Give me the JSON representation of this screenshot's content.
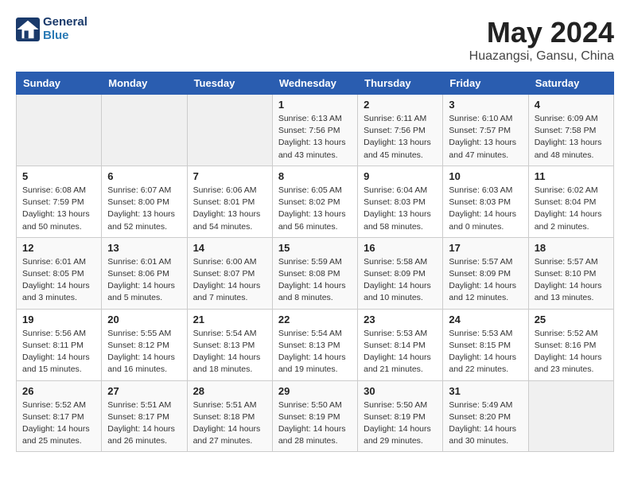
{
  "header": {
    "logo_text_general": "General",
    "logo_text_blue": "Blue",
    "month": "May 2024",
    "location": "Huazangsi, Gansu, China"
  },
  "days_of_week": [
    "Sunday",
    "Monday",
    "Tuesday",
    "Wednesday",
    "Thursday",
    "Friday",
    "Saturday"
  ],
  "weeks": [
    [
      {
        "day": "",
        "info": ""
      },
      {
        "day": "",
        "info": ""
      },
      {
        "day": "",
        "info": ""
      },
      {
        "day": "1",
        "info": "Sunrise: 6:13 AM\nSunset: 7:56 PM\nDaylight: 13 hours\nand 43 minutes."
      },
      {
        "day": "2",
        "info": "Sunrise: 6:11 AM\nSunset: 7:56 PM\nDaylight: 13 hours\nand 45 minutes."
      },
      {
        "day": "3",
        "info": "Sunrise: 6:10 AM\nSunset: 7:57 PM\nDaylight: 13 hours\nand 47 minutes."
      },
      {
        "day": "4",
        "info": "Sunrise: 6:09 AM\nSunset: 7:58 PM\nDaylight: 13 hours\nand 48 minutes."
      }
    ],
    [
      {
        "day": "5",
        "info": "Sunrise: 6:08 AM\nSunset: 7:59 PM\nDaylight: 13 hours\nand 50 minutes."
      },
      {
        "day": "6",
        "info": "Sunrise: 6:07 AM\nSunset: 8:00 PM\nDaylight: 13 hours\nand 52 minutes."
      },
      {
        "day": "7",
        "info": "Sunrise: 6:06 AM\nSunset: 8:01 PM\nDaylight: 13 hours\nand 54 minutes."
      },
      {
        "day": "8",
        "info": "Sunrise: 6:05 AM\nSunset: 8:02 PM\nDaylight: 13 hours\nand 56 minutes."
      },
      {
        "day": "9",
        "info": "Sunrise: 6:04 AM\nSunset: 8:03 PM\nDaylight: 13 hours\nand 58 minutes."
      },
      {
        "day": "10",
        "info": "Sunrise: 6:03 AM\nSunset: 8:03 PM\nDaylight: 14 hours\nand 0 minutes."
      },
      {
        "day": "11",
        "info": "Sunrise: 6:02 AM\nSunset: 8:04 PM\nDaylight: 14 hours\nand 2 minutes."
      }
    ],
    [
      {
        "day": "12",
        "info": "Sunrise: 6:01 AM\nSunset: 8:05 PM\nDaylight: 14 hours\nand 3 minutes."
      },
      {
        "day": "13",
        "info": "Sunrise: 6:01 AM\nSunset: 8:06 PM\nDaylight: 14 hours\nand 5 minutes."
      },
      {
        "day": "14",
        "info": "Sunrise: 6:00 AM\nSunset: 8:07 PM\nDaylight: 14 hours\nand 7 minutes."
      },
      {
        "day": "15",
        "info": "Sunrise: 5:59 AM\nSunset: 8:08 PM\nDaylight: 14 hours\nand 8 minutes."
      },
      {
        "day": "16",
        "info": "Sunrise: 5:58 AM\nSunset: 8:09 PM\nDaylight: 14 hours\nand 10 minutes."
      },
      {
        "day": "17",
        "info": "Sunrise: 5:57 AM\nSunset: 8:09 PM\nDaylight: 14 hours\nand 12 minutes."
      },
      {
        "day": "18",
        "info": "Sunrise: 5:57 AM\nSunset: 8:10 PM\nDaylight: 14 hours\nand 13 minutes."
      }
    ],
    [
      {
        "day": "19",
        "info": "Sunrise: 5:56 AM\nSunset: 8:11 PM\nDaylight: 14 hours\nand 15 minutes."
      },
      {
        "day": "20",
        "info": "Sunrise: 5:55 AM\nSunset: 8:12 PM\nDaylight: 14 hours\nand 16 minutes."
      },
      {
        "day": "21",
        "info": "Sunrise: 5:54 AM\nSunset: 8:13 PM\nDaylight: 14 hours\nand 18 minutes."
      },
      {
        "day": "22",
        "info": "Sunrise: 5:54 AM\nSunset: 8:13 PM\nDaylight: 14 hours\nand 19 minutes."
      },
      {
        "day": "23",
        "info": "Sunrise: 5:53 AM\nSunset: 8:14 PM\nDaylight: 14 hours\nand 21 minutes."
      },
      {
        "day": "24",
        "info": "Sunrise: 5:53 AM\nSunset: 8:15 PM\nDaylight: 14 hours\nand 22 minutes."
      },
      {
        "day": "25",
        "info": "Sunrise: 5:52 AM\nSunset: 8:16 PM\nDaylight: 14 hours\nand 23 minutes."
      }
    ],
    [
      {
        "day": "26",
        "info": "Sunrise: 5:52 AM\nSunset: 8:17 PM\nDaylight: 14 hours\nand 25 minutes."
      },
      {
        "day": "27",
        "info": "Sunrise: 5:51 AM\nSunset: 8:17 PM\nDaylight: 14 hours\nand 26 minutes."
      },
      {
        "day": "28",
        "info": "Sunrise: 5:51 AM\nSunset: 8:18 PM\nDaylight: 14 hours\nand 27 minutes."
      },
      {
        "day": "29",
        "info": "Sunrise: 5:50 AM\nSunset: 8:19 PM\nDaylight: 14 hours\nand 28 minutes."
      },
      {
        "day": "30",
        "info": "Sunrise: 5:50 AM\nSunset: 8:19 PM\nDaylight: 14 hours\nand 29 minutes."
      },
      {
        "day": "31",
        "info": "Sunrise: 5:49 AM\nSunset: 8:20 PM\nDaylight: 14 hours\nand 30 minutes."
      },
      {
        "day": "",
        "info": ""
      }
    ]
  ]
}
